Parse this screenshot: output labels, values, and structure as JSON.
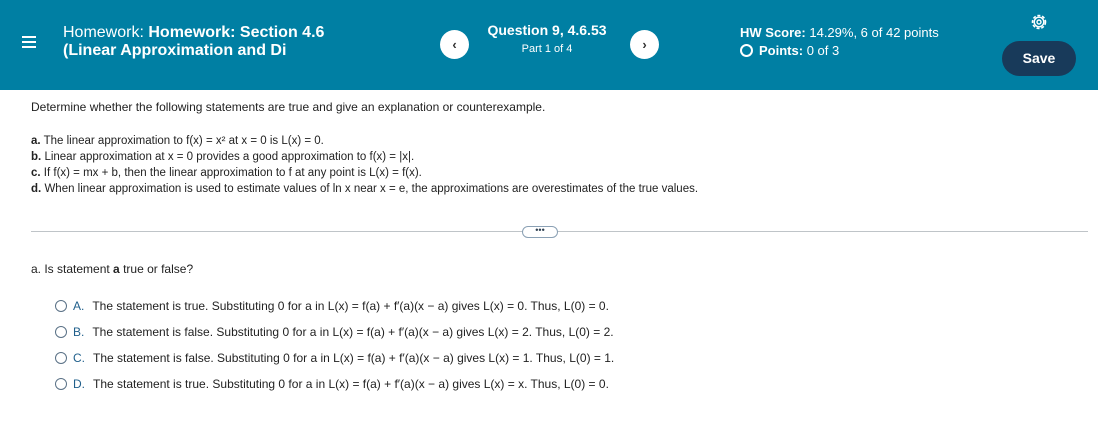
{
  "header": {
    "title_prefix": "Homework:",
    "title_bold": "Homework: Section 4.6",
    "title_line2": "(Linear Approximation and Di",
    "question_label": "Question 9, 4.6.53",
    "part_label": "Part 1 of 4",
    "prev_glyph": "‹",
    "next_glyph": "›",
    "hw_score_label": "HW Score:",
    "hw_score_value": "14.29%, 6 of 42 points",
    "points_label": "Points:",
    "points_value": "0 of 3",
    "save_label": "Save",
    "accent_color": "#007fa3",
    "save_color": "#183a5a",
    "settings_icon": "gear-icon",
    "menu_icon": "hamburger-icon"
  },
  "problem": {
    "instruction": "Determine whether the following statements are true and give an explanation or counterexample.",
    "statements": [
      {
        "letter": "a.",
        "text": "The linear approximation to f(x) = x² at x = 0 is L(x) = 0."
      },
      {
        "letter": "b.",
        "text": "Linear approximation at x = 0 provides a good approximation to f(x) = |x|."
      },
      {
        "letter": "c.",
        "text": "If f(x) = mx + b, then the linear approximation to f at any point is L(x) = f(x)."
      },
      {
        "letter": "d.",
        "text": "When linear approximation is used to estimate values of ln x near x = e, the approximations are overestimates of the true values."
      }
    ],
    "more_label": "•••"
  },
  "question": {
    "prefix": "a. Is statement",
    "bold": "a",
    "suffix": "true or false?",
    "choices": [
      {
        "letter": "A.",
        "text": "The statement is true. Substituting 0 for a in L(x) = f(a) + f′(a)(x − a) gives L(x) = 0. Thus, L(0) = 0."
      },
      {
        "letter": "B.",
        "text": "The statement is false. Substituting 0 for a in L(x) = f(a) + f′(a)(x − a) gives L(x) = 2. Thus, L(0) = 2."
      },
      {
        "letter": "C.",
        "text": "The statement is false. Substituting 0 for a in L(x) = f(a) + f′(a)(x − a) gives L(x) = 1. Thus, L(0) = 1."
      },
      {
        "letter": "D.",
        "text": "The statement is true. Substituting 0 for a in L(x) = f(a) + f′(a)(x − a) gives L(x) = x. Thus, L(0) = 0."
      }
    ]
  }
}
